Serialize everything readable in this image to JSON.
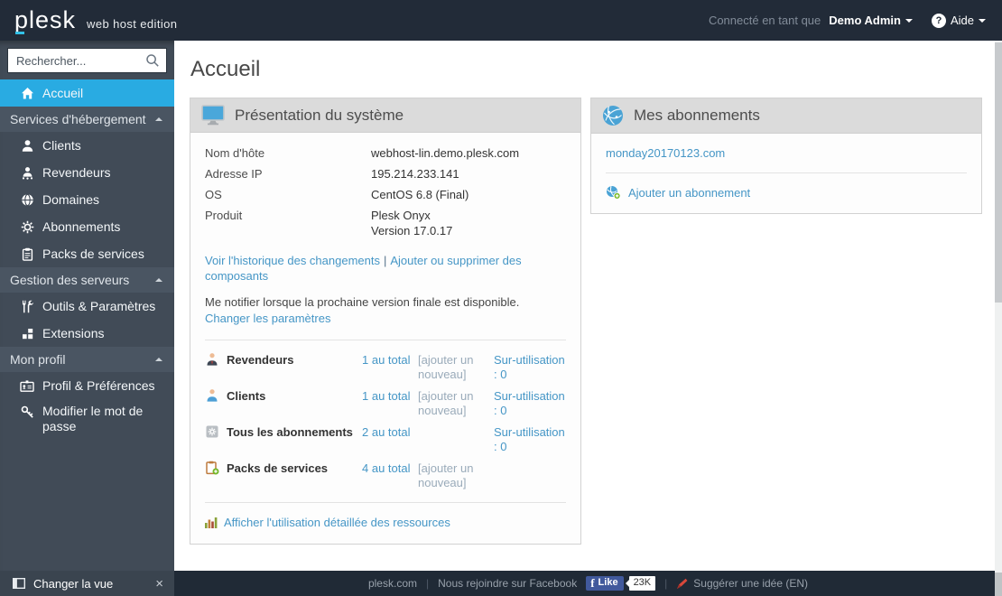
{
  "topbar": {
    "logo": "plesk",
    "edition": "web host edition",
    "connected_label": "Connecté en tant que",
    "user_name": "Demo Admin",
    "help_icon_char": "?",
    "help_label": "Aide"
  },
  "sidebar": {
    "search_placeholder": "Rechercher...",
    "home_label": "Accueil",
    "sections": [
      {
        "label": "Services d'hébergement",
        "items": [
          {
            "label": "Clients"
          },
          {
            "label": "Revendeurs"
          },
          {
            "label": "Domaines"
          },
          {
            "label": "Abonnements"
          },
          {
            "label": "Packs de services"
          }
        ]
      },
      {
        "label": "Gestion des serveurs",
        "items": [
          {
            "label": "Outils & Paramètres"
          },
          {
            "label": "Extensions"
          }
        ]
      },
      {
        "label": "Mon profil",
        "items": [
          {
            "label": "Profil & Préférences"
          },
          {
            "label": "Modifier le mot de passe"
          }
        ]
      }
    ],
    "view_switcher_label": "Changer la vue",
    "view_switcher_close": "×"
  },
  "page": {
    "title": "Accueil"
  },
  "system_panel": {
    "title": "Présentation du système",
    "info": [
      {
        "label": "Nom d'hôte",
        "value": "webhost-lin.demo.plesk.com"
      },
      {
        "label": "Adresse IP",
        "value": "195.214.233.141"
      },
      {
        "label": "OS",
        "value": "CentOS 6.8 (Final)"
      },
      {
        "label": "Produit",
        "value": "Plesk Onyx",
        "value2": "Version 17.0.17"
      }
    ],
    "links": {
      "changelog": "Voir l'historique des changements",
      "separator": "|",
      "components": "Ajouter ou supprimer des composants",
      "notify_text": "Me notifier lorsque la prochaine version finale est disponible.",
      "notify_link": "Changer les paramètres"
    },
    "summary": [
      {
        "label": "Revendeurs",
        "total": "1 au total",
        "add": "[ajouter un nouveau]",
        "overuse": "Sur-utilisation : 0"
      },
      {
        "label": "Clients",
        "total": "1 au total",
        "add": "[ajouter un nouveau]",
        "overuse": "Sur-utilisation : 0"
      },
      {
        "label": "Tous les abonnements",
        "total": "2 au total",
        "add": "",
        "overuse": "Sur-utilisation : 0"
      },
      {
        "label": "Packs de services",
        "total": "4 au total",
        "add": "[ajouter un nouveau]",
        "overuse": ""
      }
    ],
    "resources_link": "Afficher l'utilisation détaillée des ressources"
  },
  "subscriptions_panel": {
    "title": "Mes abonnements",
    "domain_link": "monday20170123.com",
    "add_link": "Ajouter un abonnement"
  },
  "footer": {
    "site_link": "plesk.com",
    "divider": "|",
    "facebook_label": "Nous rejoindre sur Facebook",
    "like_label": "Like",
    "like_count": "23K",
    "suggest_label": "Suggérer une idée (EN)"
  },
  "colors": {
    "accent_cyan": "#29abe2",
    "link_blue": "#4596c6",
    "topbar_bg": "#222b38",
    "sidebar_bg": "#414b57",
    "section_bg": "#4a5562",
    "panel_header_bg": "#dbdbdb",
    "footer_bg": "#202a36"
  }
}
